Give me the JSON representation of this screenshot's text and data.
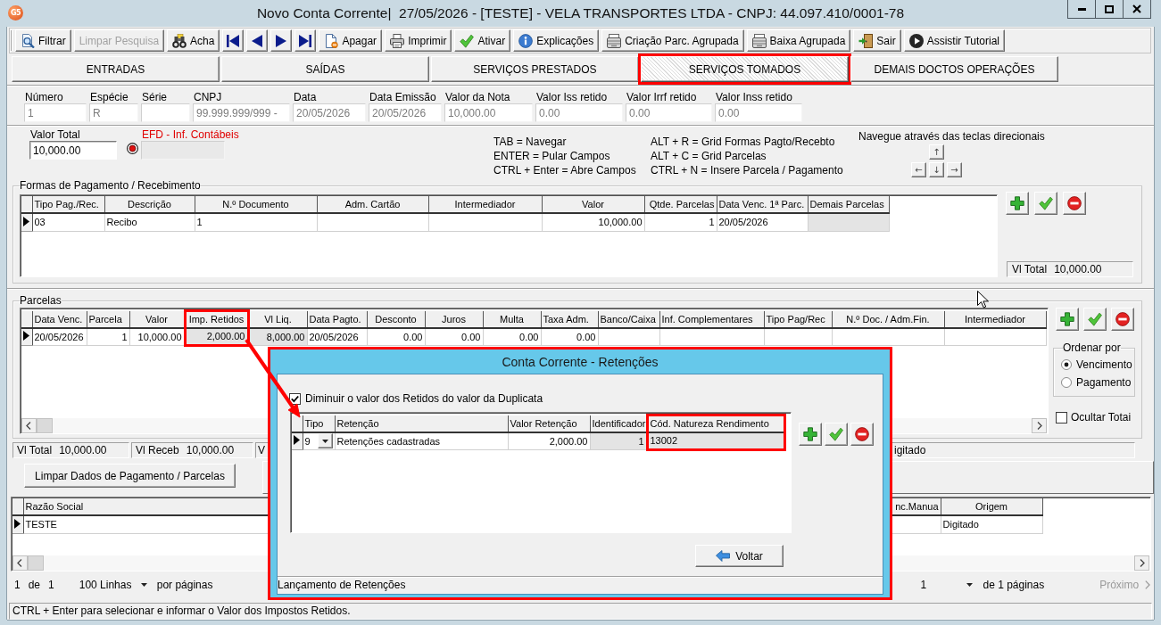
{
  "window": {
    "logo": "G5",
    "title": "Novo Conta Corrente|  27/05/2026 - [TESTE] - VELA TRANSPORTES LTDA - CNPJ: 44.097.410/0001-78"
  },
  "toolbar": [
    {
      "kind": "button",
      "label": "Filtrar",
      "disabled": false
    },
    {
      "kind": "button",
      "label": "Limpar Pesquisa",
      "disabled": true
    },
    {
      "kind": "button",
      "label": "Acha",
      "disabled": false
    },
    {
      "kind": "icon",
      "disabled": false
    },
    {
      "kind": "icon",
      "disabled": false
    },
    {
      "kind": "icon",
      "disabled": false
    },
    {
      "kind": "icon",
      "disabled": false
    },
    {
      "kind": "button",
      "label": "Apagar",
      "disabled": false
    },
    {
      "kind": "button",
      "label": "Imprimir",
      "disabled": false
    },
    {
      "kind": "button",
      "label": "Ativar",
      "disabled": false
    },
    {
      "kind": "button",
      "label": "Explicações",
      "disabled": false
    },
    {
      "kind": "button",
      "label": "Criação Parc. Agrupada",
      "disabled": false
    },
    {
      "kind": "button",
      "label": "Baixa Agrupada",
      "disabled": false
    },
    {
      "kind": "button",
      "label": "Sair",
      "disabled": false
    },
    {
      "kind": "button",
      "label": "Assistir Tutorial",
      "disabled": false
    }
  ],
  "tabs": [
    {
      "label": "ENTRADAS",
      "selected": false,
      "highlighted": false
    },
    {
      "label": "SAÍDAS",
      "selected": false,
      "highlighted": false
    },
    {
      "label": "SERVIÇOS PRESTADOS",
      "selected": false,
      "highlighted": false
    },
    {
      "label": "SERVIÇOS TOMADOS",
      "selected": true,
      "highlighted": true
    },
    {
      "label": "DEMAIS DOCTOS OPERAÇÕES",
      "selected": false,
      "highlighted": false
    }
  ],
  "fields": [
    {
      "label": "Número",
      "value": "1",
      "disabled": true
    },
    {
      "label": "Espécie",
      "value": "R",
      "disabled": true
    },
    {
      "label": "Série",
      "disabled": true
    },
    {
      "label": "CNPJ",
      "value": "99.999.999/999 -",
      "disabled": true
    },
    {
      "label": "Data",
      "value": "20/05/2026",
      "disabled": true
    },
    {
      "label": "Data Emissão",
      "value": "20/05/2026",
      "disabled": true
    },
    {
      "label": "Valor da Nota",
      "value": "10,000.00",
      "disabled": true
    },
    {
      "label": "Valor Iss retido",
      "value": "0.00",
      "disabled": true
    },
    {
      "label": "Valor Irrf retido",
      "value": "0.00",
      "disabled": true
    },
    {
      "label": "Valor Inss retido",
      "value": "0.00",
      "disabled": true
    }
  ],
  "valor_total": {
    "label": "Valor Total",
    "value": "10,000.00"
  },
  "efd": {
    "label": "EFD - Inf. Contábeis",
    "disabled": true
  },
  "shortcuts": [
    {
      "lines": [
        "TAB = Navegar",
        "ENTER = Pular Campos",
        "CTRL + Enter = Abre Campos"
      ]
    },
    {
      "lines": [
        "ALT + R = Grid Formas Pagto/Recebto",
        "ALT + C = Grid Parcelas",
        "CTRL + N = Insere Parcela / Pagamento"
      ]
    }
  ],
  "arrow_keys": {
    "hint": "Navegue através das teclas direcionais",
    "keys": [
      "↑",
      "←",
      "↓",
      "→"
    ]
  },
  "payment_methods": {
    "title": "Formas de Pagamento / Recebimento",
    "columns": [
      {
        "label": "Tipo Pag./Rec.",
        "read_only": false
      },
      {
        "label": "Descrição",
        "read_only": false
      },
      {
        "label": "N.º Documento",
        "read_only": false
      },
      {
        "label": "Adm. Cartão",
        "read_only": false
      },
      {
        "label": "Intermediador",
        "read_only": false
      },
      {
        "label": "Valor",
        "read_only": false
      },
      {
        "label": "Qtde. Parcelas",
        "read_only": false
      },
      {
        "label": "Data Venc. 1ª Parc.",
        "read_only": false
      },
      {
        "label": "Demais Parcelas",
        "read_only": true
      }
    ],
    "rows": [
      {
        "selected": true,
        "cells": [
          "03",
          "Recibo",
          "1",
          null,
          null,
          "10,000.00",
          "1",
          "20/05/2026",
          null
        ]
      }
    ],
    "total": {
      "label": "Vl Total",
      "value": "10,000.00"
    }
  },
  "installments": {
    "title": "Parcelas",
    "columns": [
      {
        "label": "Data Venc.",
        "read_only": false,
        "highlighted": false
      },
      {
        "label": "Parcela",
        "read_only": false,
        "highlighted": false
      },
      {
        "label": "Valor",
        "read_only": false,
        "highlighted": false
      },
      {
        "label": "Imp. Retidos",
        "read_only": true,
        "highlighted": true
      },
      {
        "label": "Vl Liq.",
        "read_only": true,
        "highlighted": false
      },
      {
        "label": "Data Pagto.",
        "read_only": false,
        "highlighted": false
      },
      {
        "label": "Desconto",
        "read_only": false,
        "highlighted": false
      },
      {
        "label": "Juros",
        "read_only": false,
        "highlighted": false
      },
      {
        "label": "Multa",
        "read_only": false,
        "highlighted": false
      },
      {
        "label": "Taxa Adm.",
        "read_only": false,
        "highlighted": false
      },
      {
        "label": "Banco/Caixa",
        "read_only": false,
        "highlighted": false
      },
      {
        "label": "Inf. Complementares",
        "read_only": false,
        "highlighted": false
      },
      {
        "label": "Tipo Pag/Rec",
        "read_only": false,
        "highlighted": false
      },
      {
        "label": "N.º Doc. / Adm.Fin.",
        "read_only": false,
        "highlighted": false
      },
      {
        "label": "Intermediador",
        "read_only": false,
        "highlighted": false
      }
    ],
    "rows": [
      {
        "selected": true,
        "cells": [
          "20/05/2026",
          "1",
          "10,000.00",
          "2,000.00",
          "8,000.00",
          "20/05/2026",
          "0.00",
          "0.00",
          "0.00",
          "0.00",
          null,
          null,
          null,
          null,
          null
        ]
      }
    ],
    "sort": {
      "title": "Ordenar por",
      "options": [
        {
          "label": "Vencimento",
          "selected": true
        },
        {
          "label": "Pagamento",
          "selected": false
        }
      ]
    },
    "hide_totals": {
      "label": "Ocultar Totai",
      "checked": false
    },
    "totals": [
      {
        "label": "Vl Total",
        "value": "10,000.00"
      },
      {
        "label": "Vl Receb",
        "value": "10,000.00"
      },
      {
        "label": "V"
      },
      {
        "value": "igitado"
      }
    ]
  },
  "clear_button": {
    "label": "Limpar Dados de Pagamento / Parcelas"
  },
  "companies": {
    "columns": [
      {
        "label": "Razão Social"
      },
      {
        "label": "nc.Manua"
      },
      {
        "label": "Origem"
      }
    ],
    "rows": [
      {
        "selected": true,
        "cells": [
          "TESTE",
          null,
          "Digitado"
        ]
      }
    ]
  },
  "pagination": {
    "page": "1",
    "of": "de",
    "page_count": "1",
    "page_size": "100 Linhas",
    "per_page": "por páginas",
    "current_page": "1",
    "pages_label": "de 1 páginas",
    "next": {
      "label": "Próximo",
      "disabled": true
    }
  },
  "status_bar": "CTRL + Enter para selecionar e informar o Valor dos Impostos Retidos.",
  "dialog": {
    "title": "Conta Corrente - Retenções",
    "highlighted": true,
    "option": {
      "label": "Diminuir o valor dos Retidos do valor da Duplicata",
      "checked": true
    },
    "columns": [
      {
        "label": "Tipo",
        "kind": "dropdown",
        "read_only": false,
        "highlighted": false
      },
      {
        "label": "Retenção",
        "kind": "text",
        "read_only": false,
        "highlighted": false
      },
      {
        "label": "Valor Retenção",
        "kind": "text",
        "read_only": false,
        "highlighted": false
      },
      {
        "label": "Identificador",
        "kind": "text",
        "read_only": true,
        "highlighted": false
      },
      {
        "label": "Cód. Natureza Rendimento",
        "kind": "text",
        "read_only": true,
        "highlighted": true
      }
    ],
    "rows": [
      {
        "selected": true,
        "cells": [
          "9",
          "Retenções cadastradas",
          "2,000.00",
          "1",
          "13002"
        ]
      }
    ],
    "back_button": "Voltar",
    "status": "Lançamento de Retenções"
  }
}
